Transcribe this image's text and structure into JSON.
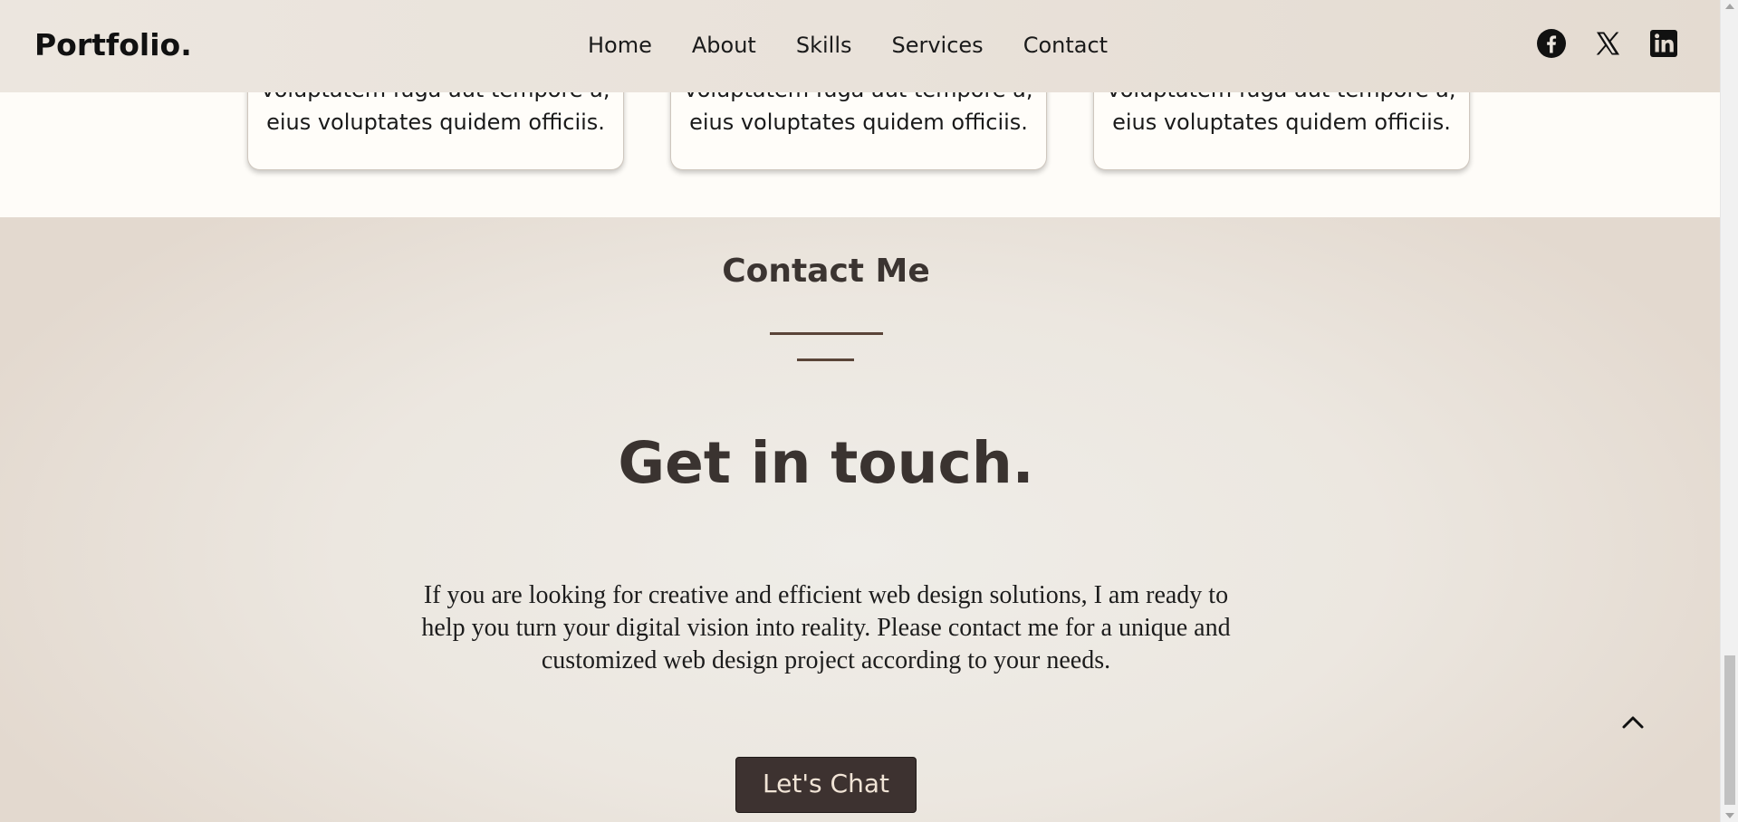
{
  "header": {
    "logo": "Portfolio.",
    "nav": [
      "Home",
      "About",
      "Skills",
      "Services",
      "Contact"
    ],
    "socials": [
      "facebook-icon",
      "x-icon",
      "linkedin-icon"
    ]
  },
  "services": {
    "cards": [
      {
        "partial_line": "voluptatem fuga aut tempore a,",
        "last_line": "eius voluptates quidem officiis."
      },
      {
        "partial_line": "voluptatem fuga aut tempore a,",
        "last_line": "eius voluptates quidem officiis."
      },
      {
        "partial_line": "voluptatem fuga aut tempore a,",
        "last_line": "eius voluptates quidem officiis."
      }
    ]
  },
  "contact": {
    "heading": "Contact Me",
    "title": "Get in touch.",
    "description": "If you are looking for creative and efficient web design solutions, I am ready to help you turn your digital vision into reality. Please contact me for a unique and customized web design project according to your needs.",
    "button_label": "Let's Chat"
  },
  "back_to_top_icon": "chevron-up-icon",
  "colors": {
    "header_bg": "#e9e2da",
    "services_bg": "#fefcf8",
    "contact_bg": "#ece7e0",
    "text_dark": "#3a3330",
    "accent_line": "#5a4438",
    "button_bg": "#3d3230",
    "button_text": "#f1e4d6"
  }
}
